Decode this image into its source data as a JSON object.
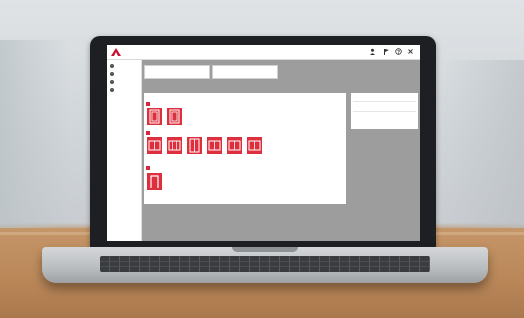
{
  "scene": {
    "description_colors": {
      "accent": "#dd2f3c",
      "screen_bg": "#9d9d9d",
      "panel_bg": "#ffffff"
    }
  },
  "app": {
    "brand": "",
    "brand_sub": ""
  },
  "topbar": {
    "icons": [
      "user-icon",
      "flag-icon",
      "help-icon",
      "close-icon"
    ]
  },
  "sidebar": {
    "items": [
      {
        "label": "",
        "icon": "home-icon"
      },
      {
        "label": "",
        "icon": "folder-icon"
      },
      {
        "label": "",
        "icon": "list-icon"
      },
      {
        "label": "",
        "icon": "settings-icon"
      }
    ]
  },
  "main": {
    "fields": [
      {
        "label": ""
      },
      {
        "label": ""
      }
    ],
    "question": "",
    "panel_hint": "",
    "groups": [
      {
        "tag": "",
        "tiles": [
          "tile-door-single",
          "tile-door-single"
        ]
      },
      {
        "tag": "",
        "tiles": [
          "tile-window",
          "tile-window",
          "tile-door-double",
          "tile-window",
          "tile-window",
          "tile-window"
        ]
      },
      {
        "tag": "",
        "tiles": [
          "tile-door-frame"
        ]
      }
    ],
    "info_panel": {
      "title": "",
      "lines": [
        "",
        ""
      ]
    }
  }
}
